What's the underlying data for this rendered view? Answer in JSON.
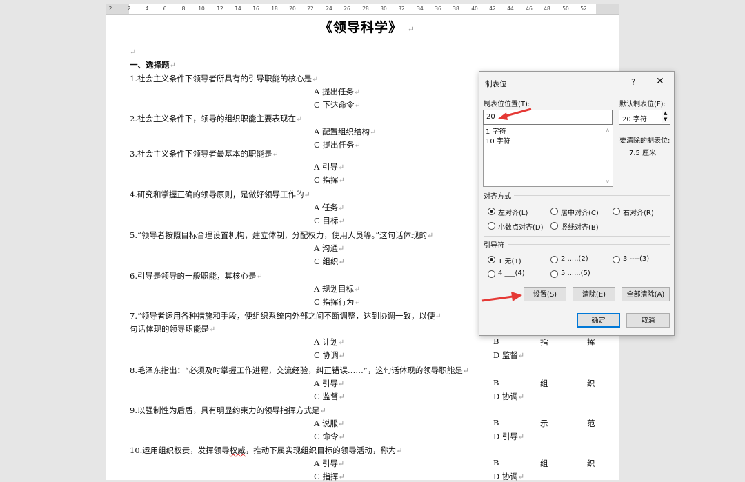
{
  "ruler": {
    "numbers": [
      "2",
      "2",
      "4",
      "6",
      "8",
      "10",
      "12",
      "14",
      "16",
      "18",
      "20",
      "22",
      "24",
      "26",
      "28",
      "30",
      "32",
      "34",
      "36",
      "38",
      "40",
      "42",
      "44",
      "46",
      "48",
      "50",
      "52"
    ]
  },
  "document": {
    "title": "《领导科学》",
    "section": "一、选择题",
    "questions": [
      {
        "q": "1.社会主义条件下领导者所具有的引导职能的核心是",
        "a": "A 提出任务",
        "c": "C 下达命令"
      },
      {
        "q": "2.社会主义条件下，领导的组织职能主要表现在",
        "a": "A 配置组织结构",
        "c": "C 提出任务"
      },
      {
        "q": "3.社会主义条件下领导者最基本的职能是",
        "a": "A 引导",
        "c": "C 指挥"
      },
      {
        "q": "4.研究和掌握正确的领导原则，是做好领导工作的",
        "a": "A 任务",
        "c": "C 目标"
      },
      {
        "q": "5.“领导者按照目标合理设置机构，建立体制，分配权力，使用人员等。”这句话体现的",
        "a": "A 沟通",
        "c": "C 组织"
      },
      {
        "q": "6.引导是领导的一般职能，其核心是",
        "a": "A 规划目标",
        "c": "C 指挥行为"
      },
      {
        "q": "7.“领导者运用各种措施和手段，使组织系统内外部之间不断调整，达到协调一致，以使",
        "q2": "句话体现的领导职能是",
        "a": "A 计划",
        "b": "B",
        "b1": "指",
        "b2": "挥",
        "c": "C 协调",
        "d": "D 监督"
      },
      {
        "q": "8.毛泽东指出：“必须及时掌握工作进程，交流经验，纠正错误……”，这句话体现的领导职能是",
        "a": "A 引导",
        "b": "B",
        "b1": "组",
        "b2": "织",
        "c": "C 监督",
        "d": "D 协调"
      },
      {
        "q": "9.以强制性为后盾，具有明显约束力的领导指挥方式是",
        "a": "A 说服",
        "b": "B",
        "b1": "示",
        "b2": "范",
        "c": "C 命令",
        "d": "D 引导"
      },
      {
        "q": "10.运用组织权责，发挥领导权威，推动下属实现组织目标的领导活动，称为",
        "a": "A 引导",
        "b": "B",
        "b1": "组",
        "b2": "织",
        "c": "C 指挥",
        "d": "D 协调"
      }
    ]
  },
  "dialog": {
    "title": "制表位",
    "help": "?",
    "close": "✕",
    "tab_position_label": "制表位位置(T):",
    "tab_position_value": "20",
    "tab_list": [
      "1 字符",
      "10 字符"
    ],
    "default_tab_label": "默认制表位(F):",
    "default_tab_value": "20 字符",
    "clear_label": "要清除的制表位:",
    "clear_value": "7.5 厘米",
    "alignment_label": "对齐方式",
    "alignment": [
      "左对齐(L)",
      "居中对齐(C)",
      "右对齐(R)",
      "小数点对齐(D)",
      "竖线对齐(B)"
    ],
    "leader_label": "引导符",
    "leaders": [
      "1 无(1)",
      "2 .....(2)",
      "3 ----(3)",
      "4 ___(4)",
      "5 ......(5)"
    ],
    "set_button": "设置(S)",
    "clear_button": "清除(E)",
    "clear_all_button": "全部清除(A)",
    "ok_button": "确定",
    "cancel_button": "取消"
  },
  "colors": {
    "arrow": "#e53935",
    "accent": "#0078d7"
  }
}
